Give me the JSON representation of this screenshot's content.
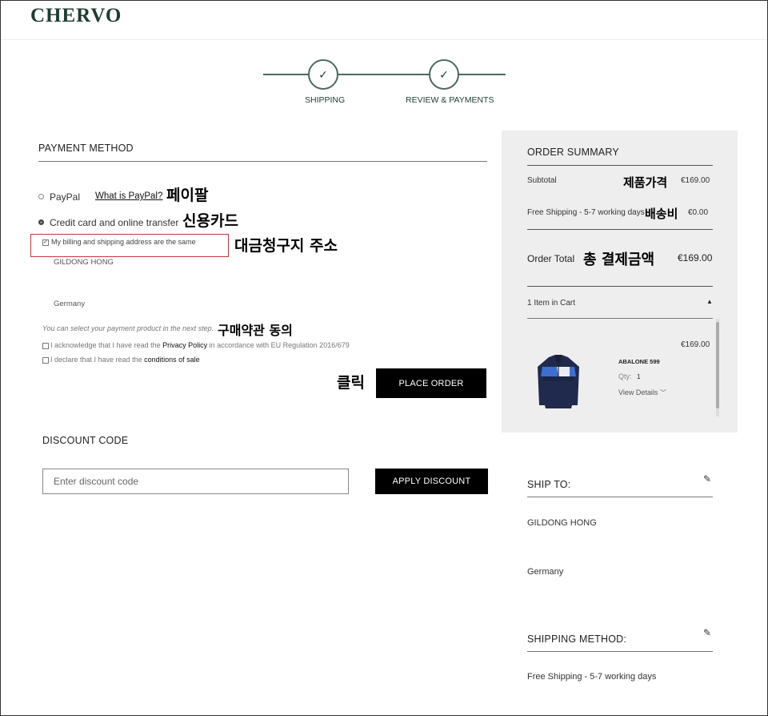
{
  "header": {
    "logo": "CHERVO"
  },
  "steps": [
    {
      "label": "SHIPPING",
      "icon": "check-icon"
    },
    {
      "label": "REVIEW & PAYMENTS",
      "icon": "check-icon"
    }
  ],
  "payment": {
    "title": "PAYMENT METHOD",
    "paypal_label": "PayPal",
    "paypal_link": "What is PayPal?",
    "paypal_annotation": "페이팔",
    "credit_label": "Credit card and online transfer",
    "credit_annotation": "신용카드",
    "billing_same_label": "My billing and shipping address are the same",
    "billing_annotation": "대금청구지 주소",
    "address_name": "GILDONG HONG",
    "address_country": "Germany",
    "next_step_note": "You can select your payment product in the next step.",
    "terms_annotation": "구매약관 동의",
    "privacy_pre": "I acknowledge that I have read the ",
    "privacy_link": "Privacy Policy",
    "privacy_post": " in accordance with EU Regulation 2016/679",
    "conditions_pre": "I declare that I have read the ",
    "conditions_link": "conditions of sale",
    "click_annotation": "클릭",
    "place_order": "PLACE ORDER"
  },
  "discount": {
    "title": "DISCOUNT CODE",
    "placeholder": "Enter discount code",
    "apply": "APPLY DISCOUNT"
  },
  "summary": {
    "title": "ORDER SUMMARY",
    "subtotal_label": "Subtotal",
    "subtotal_annotation": "제품가격",
    "subtotal_value": "€169.00",
    "shipping_label": "Free Shipping - 5-7 working days",
    "shipping_annotation": "배송비",
    "shipping_value": "€0.00",
    "total_label": "Order Total",
    "total_annotation": "총 결제금액",
    "total_value": "€169.00",
    "cart_count": "1 Item in Cart",
    "item": {
      "price": "€169.00",
      "name": "ABALONE 599",
      "qty_label": "Qty:",
      "qty_value": "1",
      "details": "View Details"
    }
  },
  "ship_to": {
    "title": "SHIP TO:",
    "name": "GILDONG HONG",
    "country": "Germany"
  },
  "shipping_method": {
    "title": "SHIPPING METHOD:",
    "value": "Free Shipping - 5-7 working days"
  },
  "colors": {
    "brand": "#1e3d30",
    "annotation_box": "#c8353a",
    "button": "#000000"
  }
}
